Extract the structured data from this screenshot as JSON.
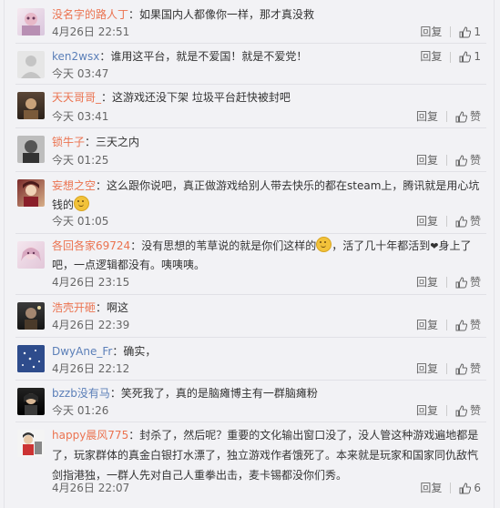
{
  "ui": {
    "reply_label": "回复",
    "like_label": "赞"
  },
  "comments": [
    {
      "user": "没名字的路人丁",
      "text": "：如果国内人都像你一样，那才真没救",
      "time": "4月26日 22:51",
      "likes": "1"
    },
    {
      "user": "ken2wsx",
      "text": "：谁用这平台，就是不爱国！就是不爱党！",
      "time": "今天 03:47",
      "likes": "1"
    },
    {
      "user": "天天哥哥_",
      "text": "：这游戏还没下架 垃圾平台赶快被封吧",
      "time": "今天 03:41",
      "likes": "赞"
    },
    {
      "user": "锁牛子",
      "text": "：三天之内",
      "time": "今天 01:25",
      "likes": "赞"
    },
    {
      "user": "妄想之空",
      "text_a": "：这么跟你说吧，真正做游戏给别人带去快乐的都在steam上，腾讯就是用心坑",
      "text_b": "钱的",
      "time": "今天 01:05",
      "likes": "赞"
    },
    {
      "user": "各回各家69724",
      "text_a": "：没有思想的苇草说的就是你们这样的",
      "text_b": "，活了几十年都活到",
      "text_c": "身上了",
      "text_d": "吧，一点逻辑都没有。咦咦咦。",
      "time": "4月26日 23:15",
      "likes": "赞"
    },
    {
      "user": "浩壳开砸",
      "text": "：啊这",
      "time": "4月26日 22:39",
      "likes": "赞"
    },
    {
      "user": "DwyAne_Fr",
      "text": "：确实，",
      "time": "4月26日 22:12",
      "likes": "赞"
    },
    {
      "user": "bzzb没有马",
      "text": "：笑死我了，真的是脑瘫博主有一群脑瘫粉",
      "time": "今天 01:26",
      "likes": "赞"
    },
    {
      "user": "happy晨风775",
      "text": "：封杀了，然后呢？重要的文化输出窗口没了，没人管这种游戏遍地都是了，玩家群体的真金白银打水漂了，独立游戏作者饿死了。本来就是玩家和国家同仇敌忾剑指港独，一群人先对自己人重拳出击，麦卡锡都没你们秀。",
      "time": "4月26日 22:07",
      "likes": "6"
    }
  ]
}
